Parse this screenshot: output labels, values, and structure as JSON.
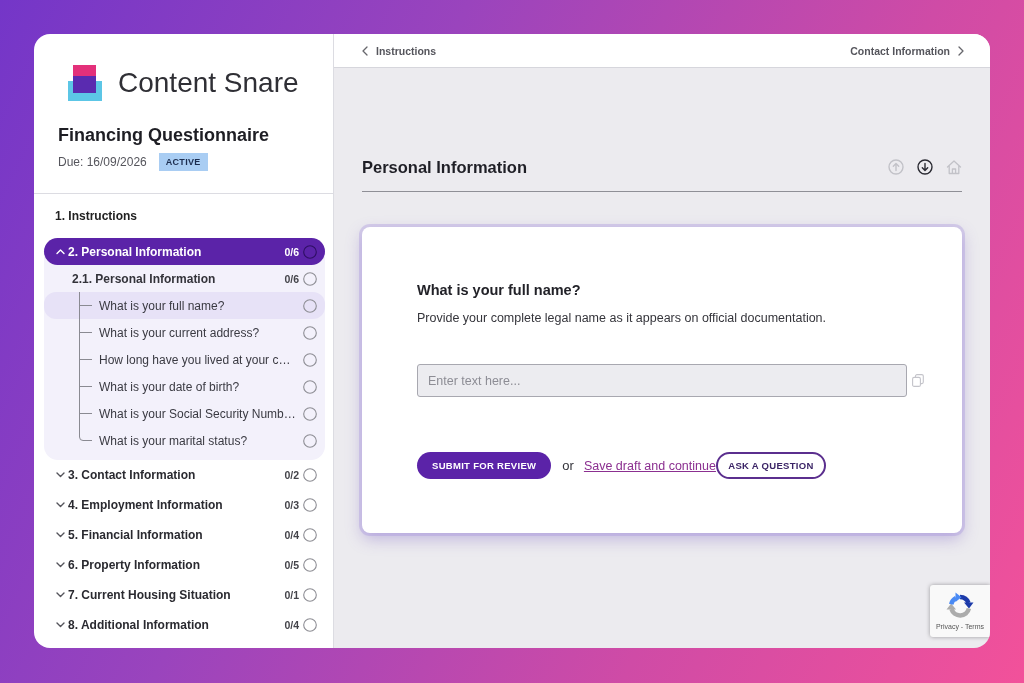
{
  "sidebar": {
    "logo": {
      "text": "Content Snare"
    },
    "title": "Financing Questionnaire",
    "due": "Due: 16/09/2026",
    "status": "ACTIVE",
    "sections": [
      {
        "kind": "page",
        "title": "1. Instructions",
        "selected": false
      },
      {
        "kind": "section",
        "title": "2. Personal Information",
        "count": "0/6",
        "complete": false,
        "expanded": true,
        "selected": true,
        "children": [
          {
            "title": "2.1. Personal Information",
            "count": "0/6",
            "complete": false,
            "children": [
              {
                "title": "What is your full name?",
                "complete": false,
                "selected": true
              },
              {
                "title": "What is your current address?",
                "complete": false,
                "selected": false
              },
              {
                "title": "How long have you lived at your c…",
                "complete": false,
                "selected": false
              },
              {
                "title": "What is your date of birth?",
                "complete": false,
                "selected": false
              },
              {
                "title": "What is your Social Security Numb…",
                "complete": false,
                "selected": false
              },
              {
                "title": "What is your marital status?",
                "complete": false,
                "selected": false
              }
            ]
          }
        ]
      },
      {
        "kind": "section",
        "title": "3. Contact Information",
        "count": "0/2",
        "complete": false,
        "expanded": false,
        "selected": false
      },
      {
        "kind": "section",
        "title": "4. Employment Information",
        "count": "0/3",
        "complete": false,
        "expanded": false,
        "selected": false
      },
      {
        "kind": "section",
        "title": "5. Financial Information",
        "count": "0/4",
        "complete": false,
        "expanded": false,
        "selected": false
      },
      {
        "kind": "section",
        "title": "6. Property Information",
        "count": "0/5",
        "complete": false,
        "expanded": false,
        "selected": false
      },
      {
        "kind": "section",
        "title": "7. Current Housing Situation",
        "count": "0/1",
        "complete": false,
        "expanded": false,
        "selected": false
      },
      {
        "kind": "section",
        "title": "8. Additional Information",
        "count": "0/4",
        "complete": false,
        "expanded": false,
        "selected": false
      }
    ]
  },
  "main": {
    "nav": {
      "previous": "Instructions",
      "next": "Contact Information"
    },
    "page_title": "Personal Information",
    "page_actions": [
      {
        "kind": "up",
        "disabled": true
      },
      {
        "kind": "down",
        "disabled": false
      },
      {
        "kind": "home",
        "disabled": true
      }
    ],
    "question": {
      "title": "What is your full name?",
      "description": "Provide your complete legal name as it appears on official documentation.",
      "input": {
        "placeholder": "Enter text here..."
      },
      "submit": "SUBMIT FOR REVIEW",
      "or": "or",
      "save_link": "Save draft and continue",
      "ask": "ASK A QUESTION"
    },
    "recaptcha": {
      "links": "Privacy - Terms"
    }
  }
}
